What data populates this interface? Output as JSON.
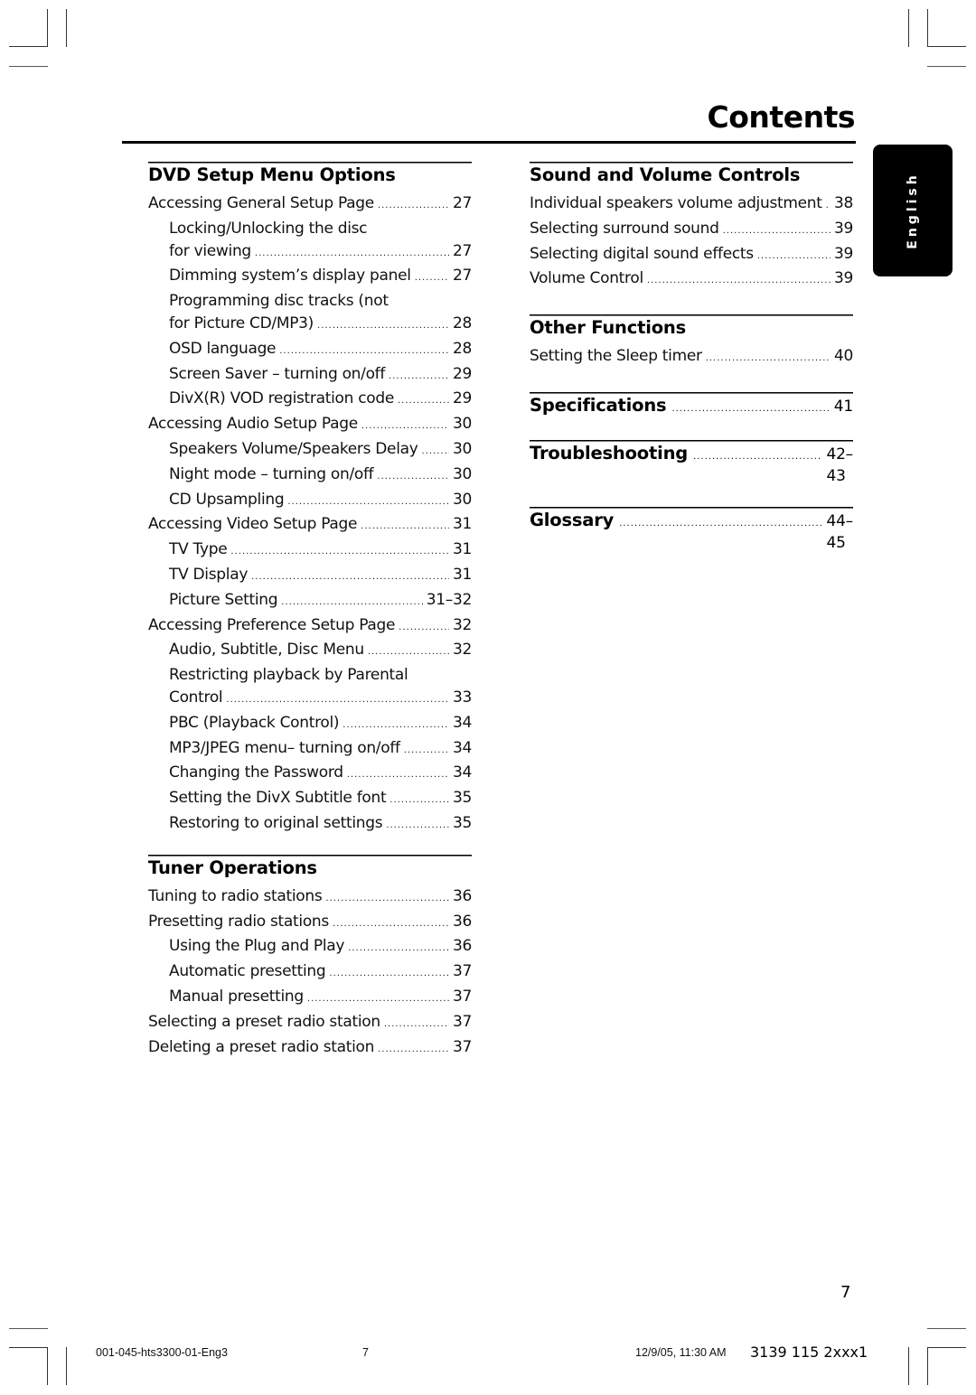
{
  "page_title": "Contents",
  "language_tab": "English",
  "left_column": [
    {
      "heading": "DVD Setup Menu Options",
      "entries": [
        {
          "label": "Accessing General Setup Page",
          "page": "27",
          "level": 0
        },
        {
          "label": "Locking/Unlocking the disc",
          "page": "",
          "level": 1
        },
        {
          "label": "for viewing",
          "page": "27",
          "level": 1
        },
        {
          "label": "Dimming system’s display panel",
          "page": "27",
          "level": 1
        },
        {
          "label": "Programming disc tracks (not",
          "page": "",
          "level": 1
        },
        {
          "label": "for Picture CD/MP3)",
          "page": "28",
          "level": 1
        },
        {
          "label": "OSD language",
          "page": "28",
          "level": 1
        },
        {
          "label": "Screen Saver – turning on/off",
          "page": "29",
          "level": 1
        },
        {
          "label": "DivX(R) VOD registration code",
          "page": "29",
          "level": 1
        },
        {
          "label": "Accessing Audio Setup Page",
          "page": "30",
          "level": 0
        },
        {
          "label": "Speakers Volume/Speakers Delay",
          "page": "30",
          "level": 1
        },
        {
          "label": "Night mode – turning on/off",
          "page": "30",
          "level": 1
        },
        {
          "label": "CD Upsampling",
          "page": "30",
          "level": 1
        },
        {
          "label": "Accessing Video Setup Page",
          "page": "31",
          "level": 0
        },
        {
          "label": "TV Type",
          "page": "31",
          "level": 1
        },
        {
          "label": "TV Display",
          "page": "31",
          "level": 1
        },
        {
          "label": "Picture Setting",
          "page": "31–32",
          "level": 1
        },
        {
          "label": "Accessing Preference Setup Page",
          "page": "32",
          "level": 0
        },
        {
          "label": "Audio, Subtitle, Disc Menu",
          "page": "32",
          "level": 1
        },
        {
          "label": "Restricting playback by Parental",
          "page": "",
          "level": 1
        },
        {
          "label": "Control",
          "page": "33",
          "level": 1
        },
        {
          "label": "PBC (Playback Control)",
          "page": "34",
          "level": 1
        },
        {
          "label": "MP3/JPEG menu– turning on/off",
          "page": "34",
          "level": 1
        },
        {
          "label": "Changing the Password",
          "page": "34",
          "level": 1
        },
        {
          "label": "Setting the DivX Subtitle font",
          "page": "35",
          "level": 1
        },
        {
          "label": "Restoring to original settings",
          "page": "35",
          "level": 1
        }
      ]
    },
    {
      "heading": "Tuner Operations",
      "entries": [
        {
          "label": "Tuning to radio stations",
          "page": "36",
          "level": 0
        },
        {
          "label": "Presetting radio stations",
          "page": "36",
          "level": 0
        },
        {
          "label": "Using the Plug and Play",
          "page": "36",
          "level": 1
        },
        {
          "label": "Automatic presetting",
          "page": "37",
          "level": 1
        },
        {
          "label": "Manual presetting",
          "page": "37",
          "level": 1
        },
        {
          "label": "Selecting a preset radio station",
          "page": "37",
          "level": 0
        },
        {
          "label": "Deleting a preset radio station",
          "page": "37",
          "level": 0
        }
      ]
    }
  ],
  "right_column": [
    {
      "heading": "Sound and Volume Controls",
      "entries": [
        {
          "label": "Individual speakers volume adjustment",
          "page": "38",
          "level": 0
        },
        {
          "label": "Selecting surround sound",
          "page": "39",
          "level": 0
        },
        {
          "label": "Selecting digital sound effects",
          "page": "39",
          "level": 0
        },
        {
          "label": "Volume Control",
          "page": "39",
          "level": 0
        }
      ]
    },
    {
      "heading": "Other Functions",
      "entries": [
        {
          "label": "Setting the Sleep timer",
          "page": "40",
          "level": 0
        }
      ]
    }
  ],
  "right_headings": [
    {
      "label": "Specifications",
      "page": "41"
    },
    {
      "label": "Troubleshooting",
      "page": "42–43"
    },
    {
      "label": "Glossary",
      "page": "44–45"
    }
  ],
  "page_number": "7",
  "footer": {
    "file": "001-045-hts3300-01-Eng3",
    "page": "7",
    "timestamp": "12/9/05, 11:30 AM",
    "code": "3139 115 2xxx1"
  }
}
